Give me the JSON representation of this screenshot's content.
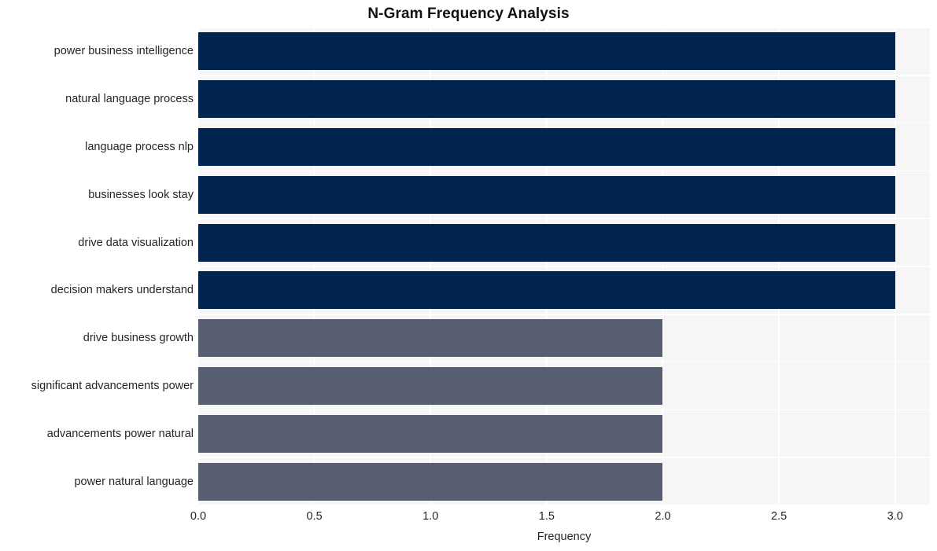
{
  "chart_data": {
    "type": "bar",
    "orientation": "horizontal",
    "title": "N-Gram Frequency Analysis",
    "xlabel": "Frequency",
    "ylabel": "",
    "xlim": [
      0,
      3.15
    ],
    "xticks": [
      "0.0",
      "0.5",
      "1.0",
      "1.5",
      "2.0",
      "2.5",
      "3.0"
    ],
    "xtick_values": [
      0.0,
      0.5,
      1.0,
      1.5,
      2.0,
      2.5,
      3.0
    ],
    "grid": true,
    "legend": "none",
    "categories": [
      "power business intelligence",
      "natural language process",
      "language process nlp",
      "businesses look stay",
      "drive data visualization",
      "decision makers understand",
      "drive business growth",
      "significant advancements power",
      "advancements power natural",
      "power natural language"
    ],
    "values": [
      3,
      3,
      3,
      3,
      3,
      3,
      2,
      2,
      2,
      2
    ],
    "bar_colors": [
      "#022450",
      "#022450",
      "#022450",
      "#022450",
      "#022450",
      "#022450",
      "#575e72",
      "#575e72",
      "#575e72",
      "#575e72"
    ],
    "plot_background": "#f6f6f6",
    "gridline_color": "#ffffff",
    "figure_background": "#ffffff",
    "text_color": "#262626",
    "title_color": "#111111"
  }
}
